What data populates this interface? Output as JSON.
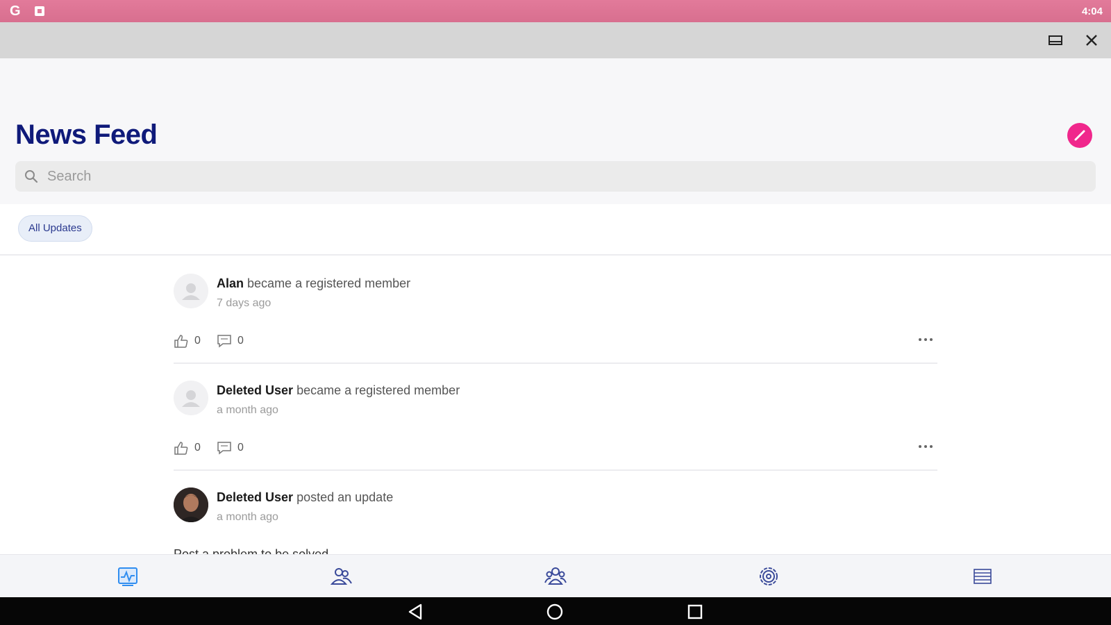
{
  "status_bar": {
    "time": "4:04",
    "google_glyph": "G"
  },
  "window": {
    "restore_icon": "restore-window-icon",
    "close_icon": "close-icon"
  },
  "header": {
    "title": "News Feed",
    "compose_icon": "pencil-icon",
    "compose_color": "#f0278c",
    "title_color": "#0f1a7a"
  },
  "search": {
    "placeholder": "Search",
    "value": ""
  },
  "filters": {
    "active_chip": "All Updates"
  },
  "feed": {
    "posts": [
      {
        "name": "Alan",
        "action": "became a registered member",
        "time": "7 days ago",
        "likes": "0",
        "comments": "0"
      },
      {
        "name": "Deleted User",
        "action": "became a registered member",
        "time": "a month ago",
        "likes": "0",
        "comments": "0"
      },
      {
        "name": "Deleted User",
        "action": "posted an update",
        "time": "a month ago",
        "body": "Post a problem to be solved"
      }
    ]
  },
  "bottom_nav": {
    "items": [
      {
        "icon": "activity-icon",
        "active": true
      },
      {
        "icon": "members-icon",
        "active": false
      },
      {
        "icon": "groups-icon",
        "active": false
      },
      {
        "icon": "settings-icon",
        "active": false
      },
      {
        "icon": "menu-list-icon",
        "active": false
      }
    ],
    "active_color": "#2f8df0",
    "inactive_color": "#3a4a9a"
  }
}
